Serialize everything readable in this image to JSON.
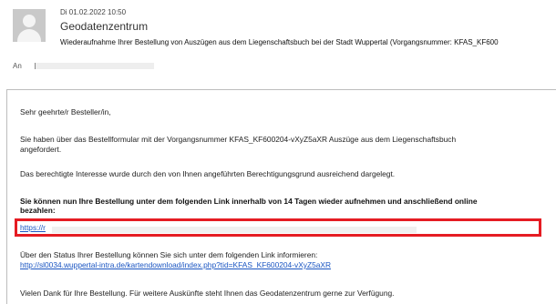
{
  "header": {
    "date": "Di 01.02.2022 10:50",
    "sender": "Geodatenzentrum",
    "subject": "Wiederaufnahme Ihrer Bestellung von Auszügen aus dem Liegenschaftsbuch bei der Stadt Wuppertal (Vorgangsnummer: KFAS_KF600",
    "to_label": "An"
  },
  "body": {
    "greeting": "Sehr geehrte/r Besteller/in,",
    "p1_line1": "Sie haben über das Bestellformular mit der Vorgangsnummer KFAS_KF600204-vXyZ5aXR Auszüge aus dem Liegenschaftsbuch",
    "p1_line2": "angefordert.",
    "p2": "Das berechtigte Interesse wurde durch den von Ihnen angeführten Berechtigungsgrund ausreichend dargelegt.",
    "p3_line1": "Sie können nun Ihre Bestellung unter dem folgenden Link innerhalb von 14 Tagen wieder aufnehmen und anschließend online",
    "p3_line2": "bezahlen:",
    "resume_link": "https://r",
    "p4": "Über den Status Ihrer Bestellung können Sie sich unter dem folgenden Link informieren:",
    "status_link": "http://sl0034.wuppertal-intra.de/kartendownload/index.php?tid=KFAS_KF600204-vXyZ5aXR",
    "closing": "Vielen Dank für Ihre Bestellung. Für weitere Auskünfte steht Ihnen das Geodatenzentrum gerne zur Verfügung."
  },
  "colors": {
    "highlight": "#e51c23",
    "link": "#1a55c2"
  },
  "icons": {
    "avatar": "person-avatar-icon"
  }
}
